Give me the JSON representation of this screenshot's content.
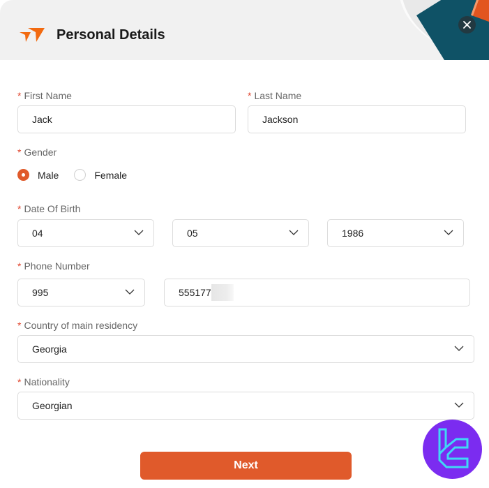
{
  "header": {
    "title": "Personal Details",
    "logo_icon": "paper-plane-arrows-logo",
    "close_icon": "close-icon"
  },
  "form": {
    "first_name": {
      "label": "First Name",
      "required_mark": "*",
      "value": "Jack"
    },
    "last_name": {
      "label": "Last Name",
      "required_mark": "*",
      "value": "Jackson"
    },
    "gender": {
      "label": "Gender",
      "required_mark": "*",
      "options": [
        {
          "label": "Male",
          "checked": true
        },
        {
          "label": "Female",
          "checked": false
        }
      ]
    },
    "date_of_birth": {
      "label": "Date Of Birth",
      "required_mark": "*",
      "day": "04",
      "month": "05",
      "year": "1986"
    },
    "phone_number": {
      "label": "Phone Number",
      "required_mark": "*",
      "country_code": "995",
      "number": "555177"
    },
    "country_of_residency": {
      "label": "Country of main residency",
      "required_mark": "*",
      "value": "Georgia"
    },
    "nationality": {
      "label": "Nationality",
      "required_mark": "*",
      "value": "Georgian"
    }
  },
  "actions": {
    "next_label": "Next"
  },
  "colors": {
    "accent": "#e05a2b",
    "required": "#e0452d",
    "header_bg": "#f1f1f1",
    "watermark": "#7b2cf0"
  }
}
